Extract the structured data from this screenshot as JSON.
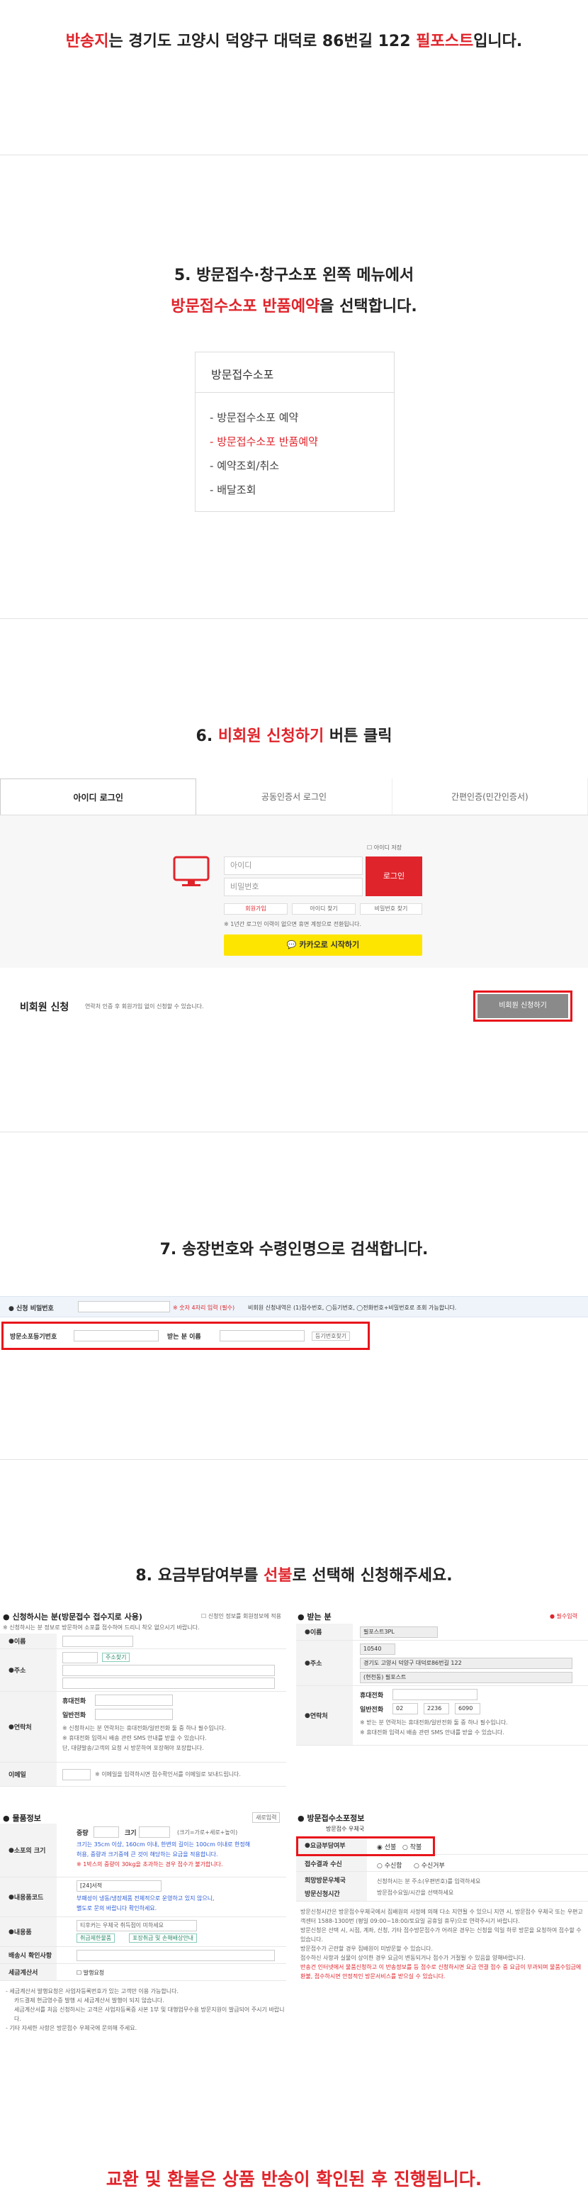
{
  "intro": {
    "part1": "반송지",
    "part2": "는 경기도 고양시 덕양구 대덕로 86번길 122 ",
    "part3": "필포스트",
    "part4": "입니다."
  },
  "step5": {
    "line1": "5. 방문접수·창구소포 왼쪽 메뉴에서",
    "line2_red": "방문접수소포 반품예약",
    "line2_rest": "을 선택합니다.",
    "menu_title": "방문접수소포",
    "menu_items": [
      "방문접수소포 예약",
      "방문접수소포 반품예약",
      "예약조회/취소",
      "배달조회"
    ]
  },
  "step6": {
    "title_pre": "6. ",
    "title_red": "비회원 신청하기",
    "title_post": " 버튼 클릭",
    "tabs": [
      "아이디 로그인",
      "공동인증서 로그인",
      "간편인증(민간인증서)"
    ],
    "save_id": "아이디 저장",
    "id_placeholder": "아이디",
    "pw_placeholder": "비밀번호",
    "login_btn": "로그인",
    "join_btn": "회원가입",
    "find_id_btn": "아이디 찾기",
    "find_pw_btn": "비밀번호 찾기",
    "notice": "※ 1년간 로그인 이력이 없으면 휴면 계정으로 전환됩니다.",
    "notice_red": "휴면 계정",
    "kakao_btn": "카카오로 시작하기",
    "nonmember_title": "비회원 신청",
    "nonmember_desc": "연락처 인증 후 회원가입 없이 신청할 수 있습니다.",
    "nonmember_btn": "비회원 신청하기"
  },
  "step7": {
    "title": "7. 송장번호와 수령인명으로 검색합니다.",
    "pw_label": "신청 비밀번호",
    "pw_note": "※ 숫자 4자리 입력 (필수)",
    "pw_note2": "비회원 신청내역은 (1)접수번호, ◯등기번호, ◯전화번호+비밀번호로 조회 가능합니다.",
    "reg_label": "방문소포등기번호",
    "recv_label": "받는 분 이름",
    "search_btn": "등기번호찾기"
  },
  "step8": {
    "title_pre": "8. 요금부담여부를 ",
    "title_red": "선불",
    "title_post": "로 선택해 신청해주세요.",
    "sender_head": "신청하시는 분(방문접수 접수지로 사용)",
    "sender_sub": "※ 신청하시는 분 정보로 방문하여 소포를 접수하여 드리니 착오 없으시기 바랍니다.",
    "same_check": "신청인 정보를 회원정보에 적용",
    "sender_rows": [
      "이름",
      "주소",
      "연락처",
      "이메일"
    ],
    "search_addr_btn": "주소찾기",
    "mobile_label": "휴대전화",
    "phone_label": "일반전화",
    "contact_note1": "※ 신청하시는 분 연락처는 휴대전화/일반전화 둘 중 하나 필수입니다.",
    "contact_note2": "※ 휴대전화 입력시 배송 관련 SMS 안내를 받을 수 있습니다.",
    "contact_note3": "단, 대량발송/고객의 요청 시 방문하여 포장해야 포장합니다.",
    "email_note": "※ 이메일을 입력하시면 접수확인서를 이메일로 보내드립니다.",
    "recv_head": "받는 분",
    "recv_required": "● 필수입력",
    "recv_rows": [
      "이름",
      "주소",
      "연락처"
    ],
    "recv_name": "필포스트3PL",
    "recv_zip": "10540",
    "recv_addr": "경기도 고양시 덕양구 대덕로86번길 122",
    "recv_addr2": "(현천동) 필포스트",
    "recv_mobile": "휴대전화",
    "recv_phone": "일반전화",
    "recv_phone_vals": [
      "02",
      "2236",
      "6090"
    ],
    "recv_note1": "※ 받는 분 연락처는 휴대전화/일반전화 둘 중 하나 필수입니다.",
    "recv_note2": "※ 휴대전화 입력시 배송 관련 SMS 안내를 받을 수 있습니다.",
    "goods_head": "물품정보",
    "goods_btn": "새로입력",
    "goods_rows": [
      "소포의 크기",
      "내용품코드",
      "내용품",
      "배송시 확인사항",
      "세금계산서"
    ],
    "weight_label": "중량",
    "size_label": "크기",
    "size_note": "(크기=가로+세로+높이)",
    "goods_note1": "크기는 35cm 이상, 160cm 이내, 한변의 길이는 100cm 이내로 한정해",
    "goods_note2": "허용, 중량과 크기중에 큰 것이 해당하는 요금을 적용합니다.",
    "goods_note3": "※ 1박스의 중량이 30kg을 초과하는 경우 접수가 불가합니다.",
    "code_val": "[24]서적",
    "code_note1": "부패성이 냉동/냉장제품 전체적으로 운영하고 있지 않으니,",
    "code_note2": "별도로 문의 바랍니다 확인하세요.",
    "goods_input": "티후커는 우체국 취득점이 미하세요",
    "goods_btn1": "취급제한물품",
    "goods_btn2": "포장취급 및 손해배상안내",
    "tax_check": "발행요청",
    "foot_note1": "- 세금계산서 발행요청은 사업자등록번호가 있는 고객만 이용 가능합니다.",
    "foot_note2": "카드결제 현금영수증 발행 시 세금계산서 발행이 되지 않습니다.",
    "foot_note3": "세금계산서를 처음 신청하시는 고객은 사업자등록증 사본 1부 및 대행업무수용 방문지원이 발급되어 주시기 바랍니다.",
    "foot_note4": "- 기타 자세한 사항은 방문접수 우체국에 문의해 주세요.",
    "visit_head": "방문접수소포정보",
    "visit_sub": "방문접수 우체국",
    "pay_label": "요금부담여부",
    "pay_prepaid": "선불",
    "pay_collect": "착불",
    "recv_mode_label": "접수결과 수신",
    "recv_mode_opts": [
      "수신함",
      "수신거부"
    ],
    "visit_date_label": "희망방문우체국",
    "visit_req_label": "방문신청시간",
    "visit_date_note": "신청하시는 분 주소(우편번호)를 입력하세요",
    "visit_req_note": "방문접수요일/시간을 선택하세요",
    "visit_notes": [
      "방문신청시간은 방문접수우체국에서 집배원의 사정에 의해 다소 지연될 수 있으니 지연 시, 방문접수 우체국 또는 우편고객센터 1588-1300번 (평일 09:00~18:00/토요일 공휴일 휴무)으로 연락주시기 바랍니다.",
      "방문신청은 선택 시, 시점, 계좌, 신청, 기타 접수방문접수가 어려운 경우는 신청을 익일 하루 방문을 요청하여 접수할 수 있습니다.",
      "방문접수가 곤란할 경우 집배원이 미방문할 수 있습니다.",
      "접수하신 사항과 실물이 상이한 경우 요금이 변동되거나 접수가 거절될 수 있음을 양해바랍니다."
    ],
    "visit_notes_red": "반송건 인터넷에서 물품신청하고 이 반송정보를 등 접수로 신청하시면 요금 연결 접수 중 요금이 부과되며 물품수입금에 환불, 접수하시면 안정적인 방문서비스를 받으실 수 있습니다."
  },
  "footer": {
    "text": "교환 및 환불은 상품 반송이 확인된 후 진행됩니다."
  }
}
